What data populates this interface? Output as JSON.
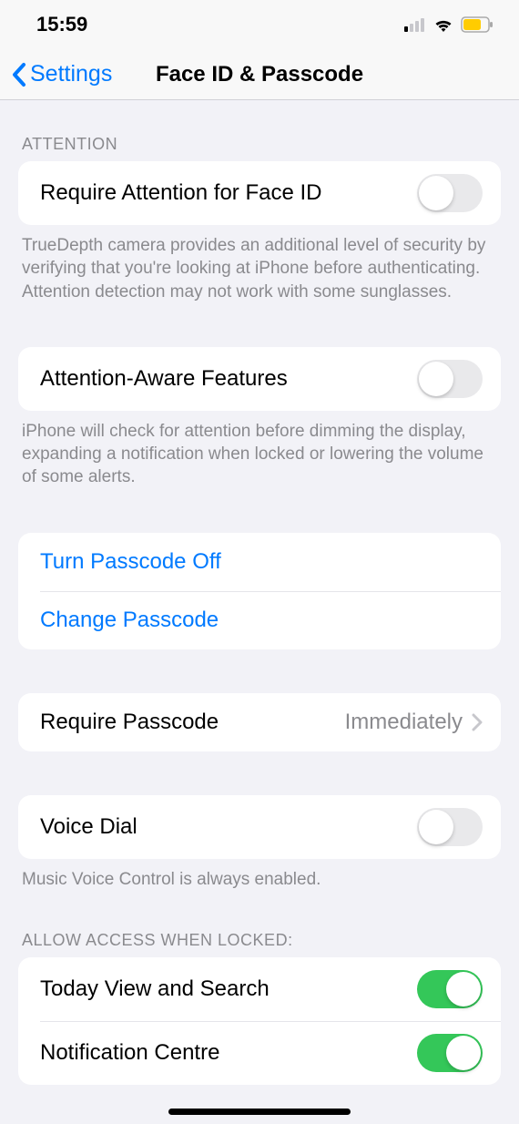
{
  "status_bar": {
    "time": "15:59"
  },
  "nav": {
    "back_label": "Settings",
    "title": "Face ID & Passcode"
  },
  "sections": {
    "attention_header": "ATTENTION",
    "require_attention": {
      "label": "Require Attention for Face ID",
      "footer": "TrueDepth camera provides an additional level of security by verifying that you're looking at iPhone before authenticating. Attention detection may not work with some sunglasses."
    },
    "attention_aware": {
      "label": "Attention-Aware Features",
      "footer": "iPhone will check for attention before dimming the display, expanding a notification when locked or lowering the volume of some alerts."
    },
    "passcode": {
      "turn_off": "Turn Passcode Off",
      "change": "Change Passcode"
    },
    "require_passcode": {
      "label": "Require Passcode",
      "value": "Immediately"
    },
    "voice_dial": {
      "label": "Voice Dial",
      "footer": "Music Voice Control is always enabled."
    },
    "allow_access_header": "ALLOW ACCESS WHEN LOCKED:",
    "today_view": {
      "label": "Today View and Search"
    },
    "notification_centre": {
      "label": "Notification Centre"
    }
  }
}
